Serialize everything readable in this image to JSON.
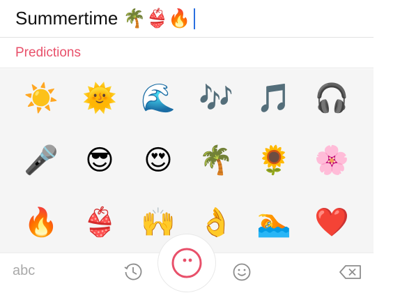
{
  "input": {
    "text": "Summertime 🌴👙🔥"
  },
  "predictions": {
    "title": "Predictions",
    "emojis": [
      "☀️",
      "🌞",
      "🌊",
      "🎶",
      "🎵",
      "🎧",
      "🎤",
      "😎",
      "😍",
      "🌴",
      "🌻",
      "🌸",
      "🔥",
      "👙",
      "🙌",
      "👌",
      "🏊",
      "❤️"
    ]
  },
  "toolbar": {
    "abc_label": "abc",
    "icons": {
      "recent": "clock-icon",
      "logo": "logo-face-icon",
      "emoji": "smiley-icon",
      "delete": "backspace-icon"
    },
    "accent_color": "#e8506a"
  },
  "colors": {
    "predictions_label": "#e8506a",
    "caret": "#2a6fe0",
    "grid_bg": "#f5f5f5"
  }
}
